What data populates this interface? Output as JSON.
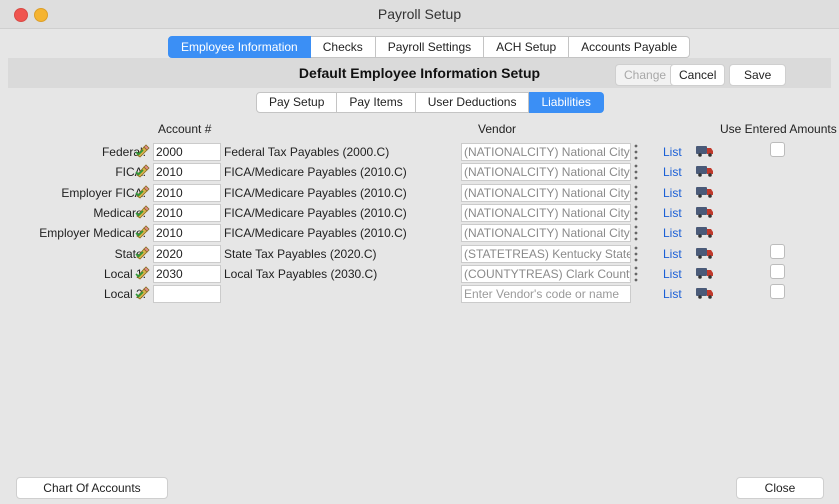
{
  "window": {
    "title": "Payroll Setup"
  },
  "tabs": [
    {
      "label": "Employee Information",
      "active": true
    },
    {
      "label": "Checks",
      "active": false
    },
    {
      "label": "Payroll Settings",
      "active": false
    },
    {
      "label": "ACH Setup",
      "active": false
    },
    {
      "label": "Accounts Payable",
      "active": false
    }
  ],
  "header": {
    "title": "Default Employee Information Setup",
    "change_label": "Change",
    "cancel_label": "Cancel",
    "save_label": "Save"
  },
  "subtabs": [
    {
      "label": "Pay Setup",
      "active": false
    },
    {
      "label": "Pay Items",
      "active": false
    },
    {
      "label": "User Deductions",
      "active": false
    },
    {
      "label": "Liabilities",
      "active": true
    }
  ],
  "columns": {
    "account": "Account #",
    "vendor": "Vendor",
    "use_entered": "Use Entered Amounts"
  },
  "rows": [
    {
      "label": "Federal:",
      "account": "2000",
      "account_name": "Federal Tax Payables (2000.C)",
      "vendor": "(NATIONALCITY) National City",
      "list": "List",
      "has_checkbox": true
    },
    {
      "label": "FICA:",
      "account": "2010",
      "account_name": "FICA/Medicare Payables (2010.C)",
      "vendor": "(NATIONALCITY) National City",
      "list": "List",
      "has_checkbox": false
    },
    {
      "label": "Employer FICA:",
      "account": "2010",
      "account_name": "FICA/Medicare Payables (2010.C)",
      "vendor": "(NATIONALCITY) National City",
      "list": "List",
      "has_checkbox": false
    },
    {
      "label": "Medicare:",
      "account": "2010",
      "account_name": "FICA/Medicare Payables (2010.C)",
      "vendor": "(NATIONALCITY) National City",
      "list": "List",
      "has_checkbox": false
    },
    {
      "label": "Employer Medicare:",
      "account": "2010",
      "account_name": "FICA/Medicare Payables (2010.C)",
      "vendor": "(NATIONALCITY) National City",
      "list": "List",
      "has_checkbox": false
    },
    {
      "label": "State:",
      "account": "2020",
      "account_name": "State Tax Payables (2020.C)",
      "vendor": "(STATETREAS) Kentucky State",
      "list": "List",
      "has_checkbox": true
    },
    {
      "label": "Local 1:",
      "account": "2030",
      "account_name": "Local Tax Payables (2030.C)",
      "vendor": "(COUNTYTREAS) Clark County",
      "list": "List",
      "has_checkbox": true
    },
    {
      "label": "Local 2:",
      "account": "",
      "account_name": "",
      "vendor": "",
      "vendor_placeholder": "Enter Vendor's code or name",
      "list": "List",
      "has_checkbox": true
    }
  ],
  "footer": {
    "chart_of_accounts_label": "Chart Of Accounts",
    "close_label": "Close"
  },
  "colors": {
    "accent": "#3b8ff5",
    "link": "#1a5fd6",
    "truck": "#4a5a78"
  },
  "icons": {
    "pencil": "pencil-check-icon",
    "truck": "truck-icon",
    "more": "kebab-icon"
  }
}
